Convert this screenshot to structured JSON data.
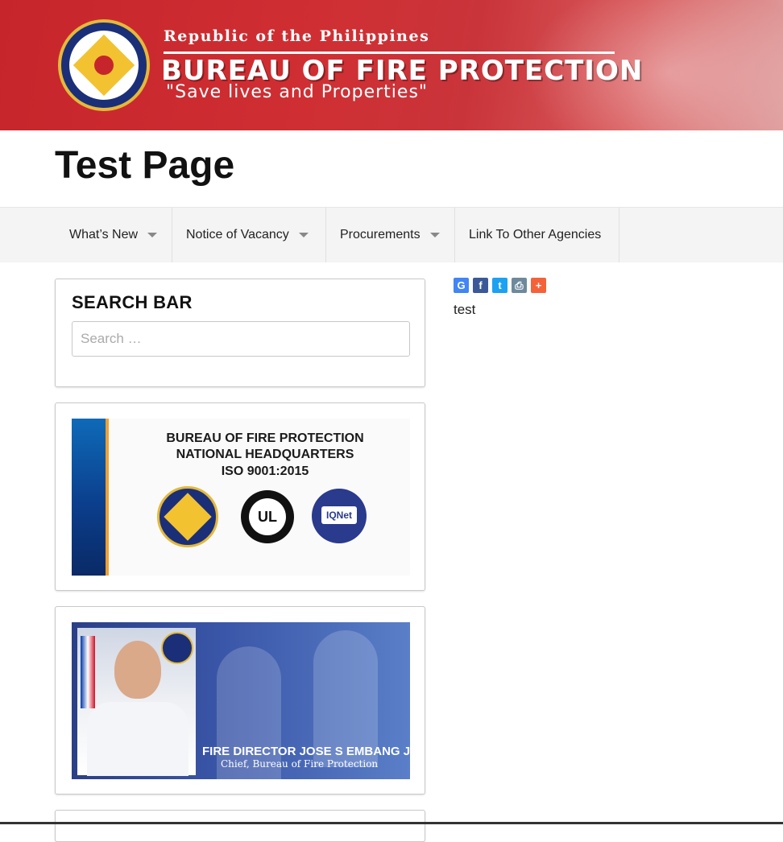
{
  "header": {
    "republic": "Republic of the Philippines",
    "bureau": "BUREAU OF FIRE PROTECTION",
    "motto": "\"Save lives and Properties\"",
    "colors": {
      "banner": "#c6262b",
      "seal_gold": "#e4b93a",
      "seal_blue": "#1b2f78"
    }
  },
  "page_title": "Test Page",
  "nav": {
    "items": [
      {
        "label": "What’s New",
        "has_dropdown": true
      },
      {
        "label": "Notice of Vacancy",
        "has_dropdown": true
      },
      {
        "label": "Procurements",
        "has_dropdown": true
      },
      {
        "label": "Link To Other Agencies",
        "has_dropdown": false
      }
    ]
  },
  "sidebar": {
    "search": {
      "title": "SEARCH BAR",
      "placeholder": "Search …"
    },
    "iso_banner": {
      "line1": "BUREAU OF FIRE PROTECTION",
      "line2": "NATIONAL HEADQUARTERS",
      "line3": "ISO 9001:2015",
      "ul_mark": "UL",
      "iqnet_mark": "IQNet"
    },
    "chief": {
      "name": "FIRE DIRECTOR JOSE S EMBANG JR",
      "role": "Chief, Bureau of Fire Protection"
    }
  },
  "share": {
    "buttons": [
      {
        "icon": "google-icon",
        "glyph": "G",
        "color": "#4285f4"
      },
      {
        "icon": "facebook-icon",
        "glyph": "f",
        "color": "#3b5998"
      },
      {
        "icon": "twitter-icon",
        "glyph": "t",
        "color": "#1da1f2"
      },
      {
        "icon": "print-icon",
        "glyph": "⎙",
        "color": "#6d8a9c"
      },
      {
        "icon": "more-icon",
        "glyph": "+",
        "color": "#f4623a"
      }
    ]
  },
  "content": {
    "text": "test"
  }
}
